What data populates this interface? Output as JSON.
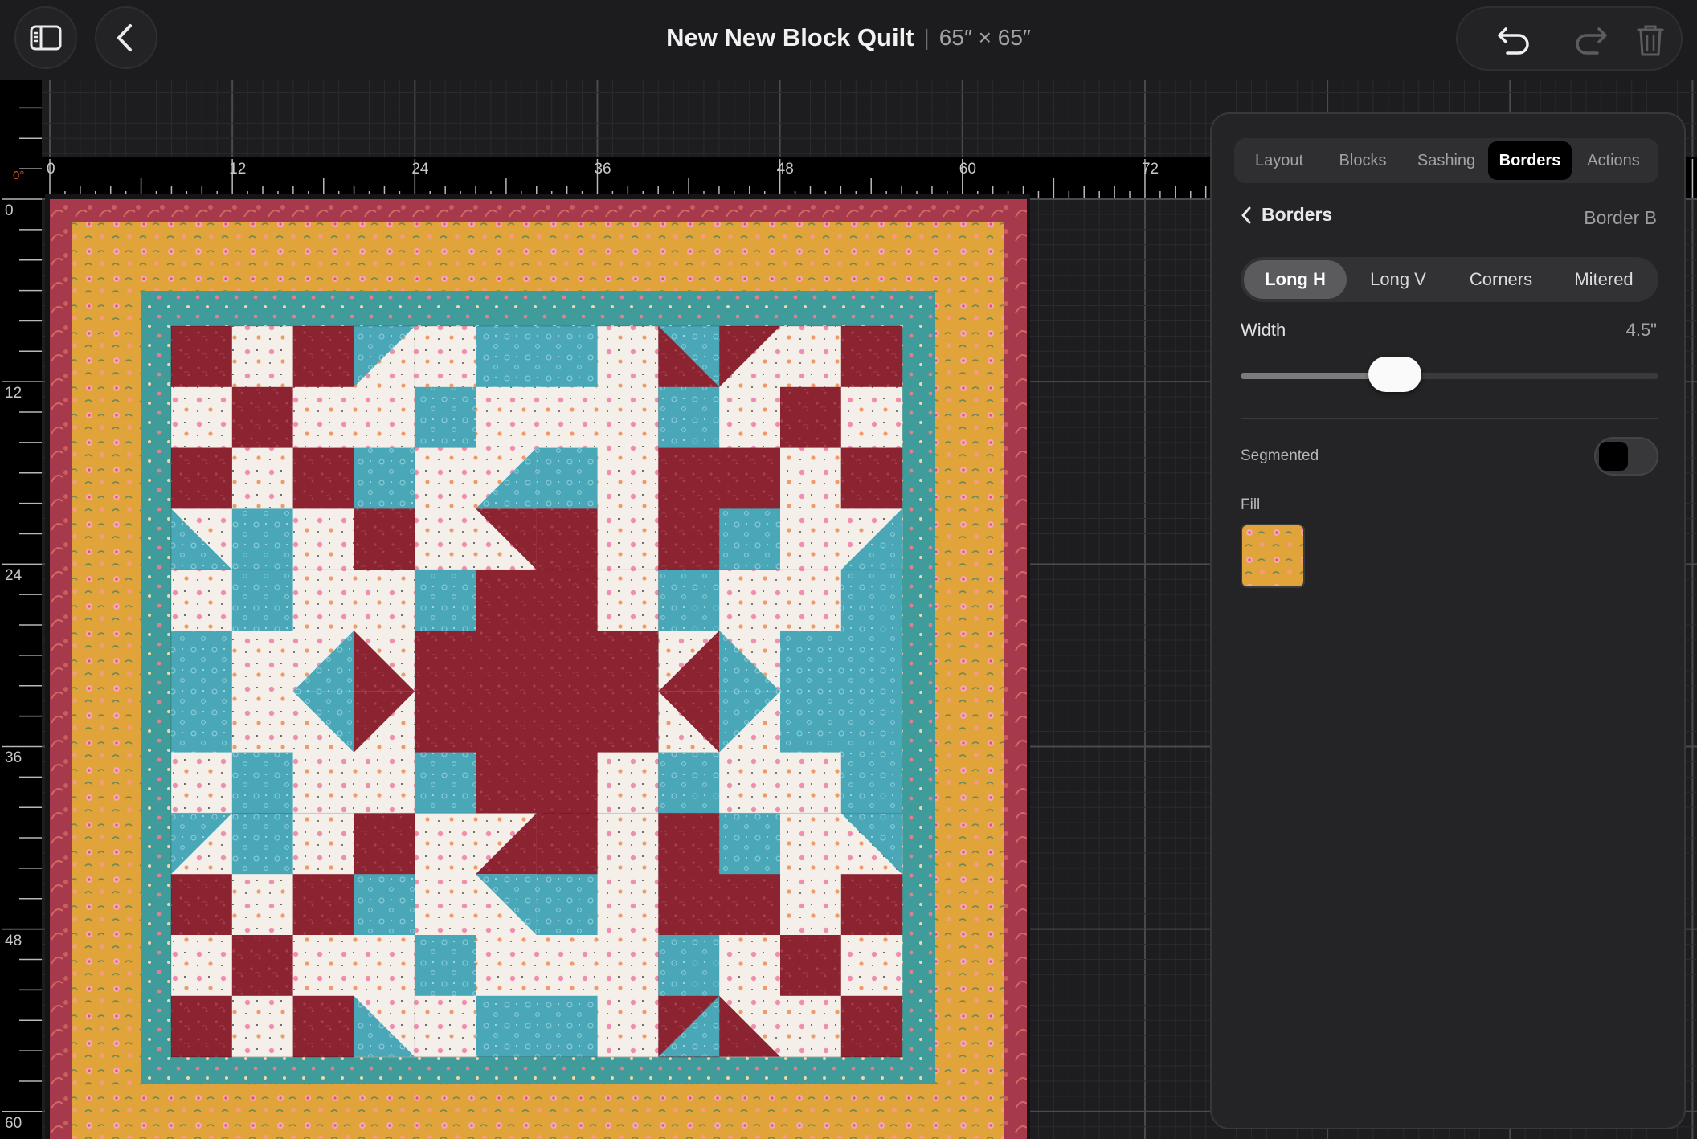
{
  "header": {
    "title": "New New Block Quilt",
    "separator": "|",
    "size": "65″ × 65″"
  },
  "ruler": {
    "angle": "0°",
    "top_labels": [
      "0",
      "12",
      "24",
      "36",
      "48",
      "60",
      "72",
      "1"
    ],
    "left_labels": [
      "0",
      "12",
      "24",
      "36",
      "48",
      "60"
    ]
  },
  "panel": {
    "tabs": [
      {
        "label": "Layout",
        "active": false
      },
      {
        "label": "Blocks",
        "active": false
      },
      {
        "label": "Sashing",
        "active": false
      },
      {
        "label": "Borders",
        "active": true
      },
      {
        "label": "Actions",
        "active": false
      }
    ],
    "back_label": "Borders",
    "current_border": "Border B",
    "segments": [
      {
        "label": "Long H",
        "active": true
      },
      {
        "label": "Long V",
        "active": false
      },
      {
        "label": "Corners",
        "active": false
      },
      {
        "label": "Mitered",
        "active": false
      }
    ],
    "width_label": "Width",
    "width_value": "4.5\"",
    "width_slider_fraction": 0.37,
    "segmented_label": "Segmented",
    "segmented_on": false,
    "fill_label": "Fill"
  },
  "colors": {
    "red": "#8b2331",
    "teal": "#4aa7b8",
    "cream": "#f4efe9",
    "gold": "#e0a43a",
    "dark_border": "#a7394d",
    "teal_border": "#3f9c9a"
  }
}
